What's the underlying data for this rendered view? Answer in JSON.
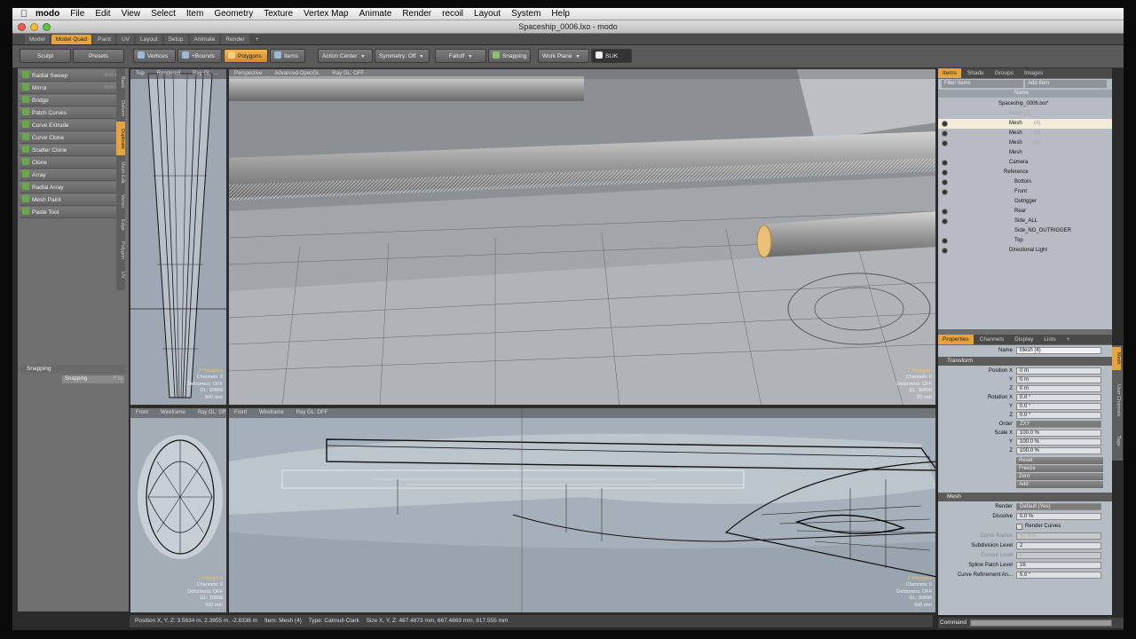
{
  "menubar": {
    "app_name": "modo",
    "items": [
      "File",
      "Edit",
      "View",
      "Select",
      "Item",
      "Geometry",
      "Texture",
      "Vertex Map",
      "Animate",
      "Render",
      "recoil",
      "Layout",
      "System",
      "Help"
    ]
  },
  "window": {
    "title": "Spaceship_0006.lxo - modo"
  },
  "layout_tabs": [
    "Model",
    "Model Quad",
    "Paint",
    "UV",
    "Layout",
    "Setup",
    "Animate",
    "Render",
    "+"
  ],
  "toolbar": {
    "sculpt": "Sculpt",
    "presets": "Presets",
    "vertices": "Vertices",
    "edges": "+Bounds",
    "polygons": "Polygons",
    "items": "Items",
    "action_center": "Action Center",
    "symmetry": "Symmetry: Off",
    "falloff": "Falloff",
    "snapping": "Snapping",
    "work_plane": "Work Plane",
    "slik": "SLIK"
  },
  "tools": [
    {
      "label": "Radial Sweep",
      "shortcut": "Shift-A"
    },
    {
      "label": "Mirror",
      "shortcut": "Shift-V"
    },
    {
      "label": "Bridge",
      "shortcut": ""
    },
    {
      "label": "Patch Curves",
      "shortcut": ""
    },
    {
      "label": "Curve Extrude",
      "shortcut": ""
    },
    {
      "label": "Curve Clone",
      "shortcut": ""
    },
    {
      "label": "Scatter Clone",
      "shortcut": ""
    },
    {
      "label": "Clone",
      "shortcut": ""
    },
    {
      "label": "Array",
      "shortcut": ""
    },
    {
      "label": "Radial Array",
      "shortcut": ""
    },
    {
      "label": "Mesh Paint",
      "shortcut": ""
    },
    {
      "label": "Paste Tool",
      "shortcut": ""
    }
  ],
  "left_tabs": [
    "Basic",
    "Deform",
    "Duplicate",
    "Mesh Edit",
    "Vertex",
    "Edge",
    "Polygon",
    "UV"
  ],
  "snapping": {
    "header": "Snapping",
    "button": "Snapping",
    "shortcut": "F11"
  },
  "viewports": {
    "top_left": {
      "header": [
        "Top",
        "Rendered",
        "Ray GL: ..."
      ],
      "stats": [
        "2 Polygons",
        "Channels: 0",
        "Deformers: OFF",
        "GL: 30898",
        "500 mm"
      ]
    },
    "top_right": {
      "header": [
        "Perspective",
        "Advanced OpenGL",
        "Ray GL: OFF"
      ],
      "stats": [
        "2 Polygons",
        "Channels: 0",
        "Deformers: OFF",
        "GL: 30898",
        "50 mm"
      ]
    },
    "bottom_left": {
      "header": [
        "Front",
        "Wireframe",
        "Ray GL: Off"
      ],
      "stats": [
        "2 Polygons",
        "Channels: 0",
        "Deformers: OFF",
        "GL: 30898",
        "500 mm"
      ]
    },
    "bottom_right": {
      "header": [
        "Front",
        "Wireframe",
        "Ray GL: OFF"
      ],
      "stats": [
        "2 Polygons",
        "Channels: 0",
        "Deformers: OFF",
        "GL: 30898",
        "500 mm"
      ]
    }
  },
  "items_panel": {
    "tabs": [
      "Items",
      "Shade",
      "Groups",
      "Images"
    ],
    "filter": "Filter Items",
    "add_item": "Add Item",
    "name_col": "Name",
    "tree": [
      {
        "label": "Spaceship_0006.lxo*",
        "indent": 0,
        "eye": false,
        "sel": false,
        "faded": false
      },
      {
        "label": "Mesh (2)",
        "indent": 2,
        "eye": false,
        "sel": false,
        "faded": true
      },
      {
        "label": "Mesh",
        "indent": 2,
        "eye": true,
        "sel": true,
        "faded": false,
        "suffix": "(4)"
      },
      {
        "label": "Mesh",
        "indent": 2,
        "eye": true,
        "sel": false,
        "faded": false,
        "suffix": "(1)"
      },
      {
        "label": "Mesh",
        "indent": 2,
        "eye": true,
        "sel": false,
        "faded": false,
        "suffix": "(3)"
      },
      {
        "label": "Mesh",
        "indent": 2,
        "eye": false,
        "sel": false,
        "faded": false
      },
      {
        "label": "Camera",
        "indent": 2,
        "eye": true,
        "sel": false,
        "faded": false
      },
      {
        "label": "Reference",
        "indent": 1,
        "eye": true,
        "sel": false,
        "faded": false
      },
      {
        "label": "Bottom",
        "indent": 3,
        "eye": true,
        "sel": false,
        "faded": false
      },
      {
        "label": "Front",
        "indent": 3,
        "eye": true,
        "sel": false,
        "faded": false
      },
      {
        "label": "Outrigger",
        "indent": 3,
        "eye": false,
        "sel": false,
        "faded": false
      },
      {
        "label": "Rear",
        "indent": 3,
        "eye": true,
        "sel": false,
        "faded": false
      },
      {
        "label": "Side_ALL",
        "indent": 3,
        "eye": true,
        "sel": false,
        "faded": false
      },
      {
        "label": "Side_NO_OUTRIGGER",
        "indent": 3,
        "eye": false,
        "sel": false,
        "faded": false
      },
      {
        "label": "Top",
        "indent": 3,
        "eye": true,
        "sel": false,
        "faded": false
      },
      {
        "label": "Directional Light",
        "indent": 2,
        "eye": true,
        "sel": false,
        "faded": false
      }
    ]
  },
  "properties": {
    "tabs": [
      "Properties",
      "Channels",
      "Display",
      "Lists",
      "+"
    ],
    "name_label": "Name",
    "name_value": "Mesh (4)",
    "transform": "Transform",
    "position": [
      {
        "k": "Position X",
        "v": "0 m"
      },
      {
        "k": "Y",
        "v": "0 m"
      },
      {
        "k": "Z",
        "v": "0 m"
      }
    ],
    "rotation": [
      {
        "k": "Rotation X",
        "v": "0.0 °"
      },
      {
        "k": "Y",
        "v": "0.0 °"
      },
      {
        "k": "Z",
        "v": "0.0 °"
      }
    ],
    "order_label": "Order",
    "order_value": "ZXY",
    "scale": [
      {
        "k": "Scale X",
        "v": "100.0 %"
      },
      {
        "k": "Y",
        "v": "100.0 %"
      },
      {
        "k": "Z",
        "v": "100.0 %"
      }
    ],
    "buttons": [
      "Reset",
      "Freeze",
      "Zero",
      "Add"
    ],
    "mesh": "Mesh",
    "render_label": "Render",
    "render_value": "Default (Yes)",
    "dissolve_label": "Dissolve",
    "dissolve_value": "0.0 %",
    "render_curves": "Render Curves",
    "curve_radius_label": "Curve Radius",
    "curve_radius_value": "50 mm",
    "subdiv_label": "Subdivision Level",
    "subdiv_value": "2",
    "current_level_label": "Current Level",
    "current_level_value": "0",
    "spline_label": "Spline Patch Level",
    "spline_value": "16",
    "curve_ref_label": "Curve Refinement An...",
    "curve_ref_value": "5.0 °"
  },
  "right_tabs": [
    "Mesh",
    "User Channels",
    "Tags"
  ],
  "statusbar": {
    "position": "Position X, Y, Z:  3.5634 m, 2.3955 m, -2.8336 m",
    "item": "Item:  Mesh (4)",
    "type": "Type:  Catmull-Clark",
    "size": "Size X, Y, Z:  487.4873 mm, 667.4869 mm, 817.555 mm"
  },
  "command": {
    "label": "Command"
  }
}
